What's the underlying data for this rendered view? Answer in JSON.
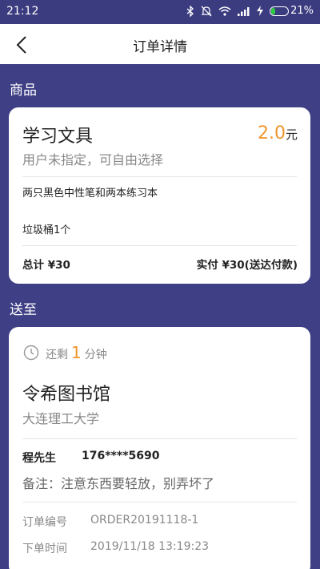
{
  "status_bar": {
    "time": "21:12",
    "battery": "21%",
    "battery_level": 0.21,
    "battery_color": "#2ecc40"
  },
  "nav": {
    "title": "订单详情"
  },
  "goods_section": {
    "label": "商品"
  },
  "goods": {
    "title": "学习文具",
    "price": "2.0",
    "price_unit": "元",
    "subtitle": "用户未指定，可自由选择",
    "description": "两只黑色中性笔和两本练习本",
    "extra": "垃圾桶1个",
    "total": "总计 ¥30",
    "paid": "实付 ¥30(送达付款)"
  },
  "delivery_section": {
    "label": "送至"
  },
  "delivery": {
    "remain_prefix": "还剩",
    "remain_num": "1",
    "remain_unit": "分钟",
    "place": "令希图书馆",
    "school": "大连理工大学",
    "contact_name": "程先生",
    "phone": "176****5690",
    "note": "备注：注意东西要轻放，别弄坏了",
    "order_no_label": "订单编号",
    "order_no": "ORDER20191118-1",
    "order_time_label": "下单时间",
    "order_time": "2019/11/18 13:19:23"
  },
  "colors": {
    "accent": "#f0962c",
    "background": "#3f3f86"
  }
}
